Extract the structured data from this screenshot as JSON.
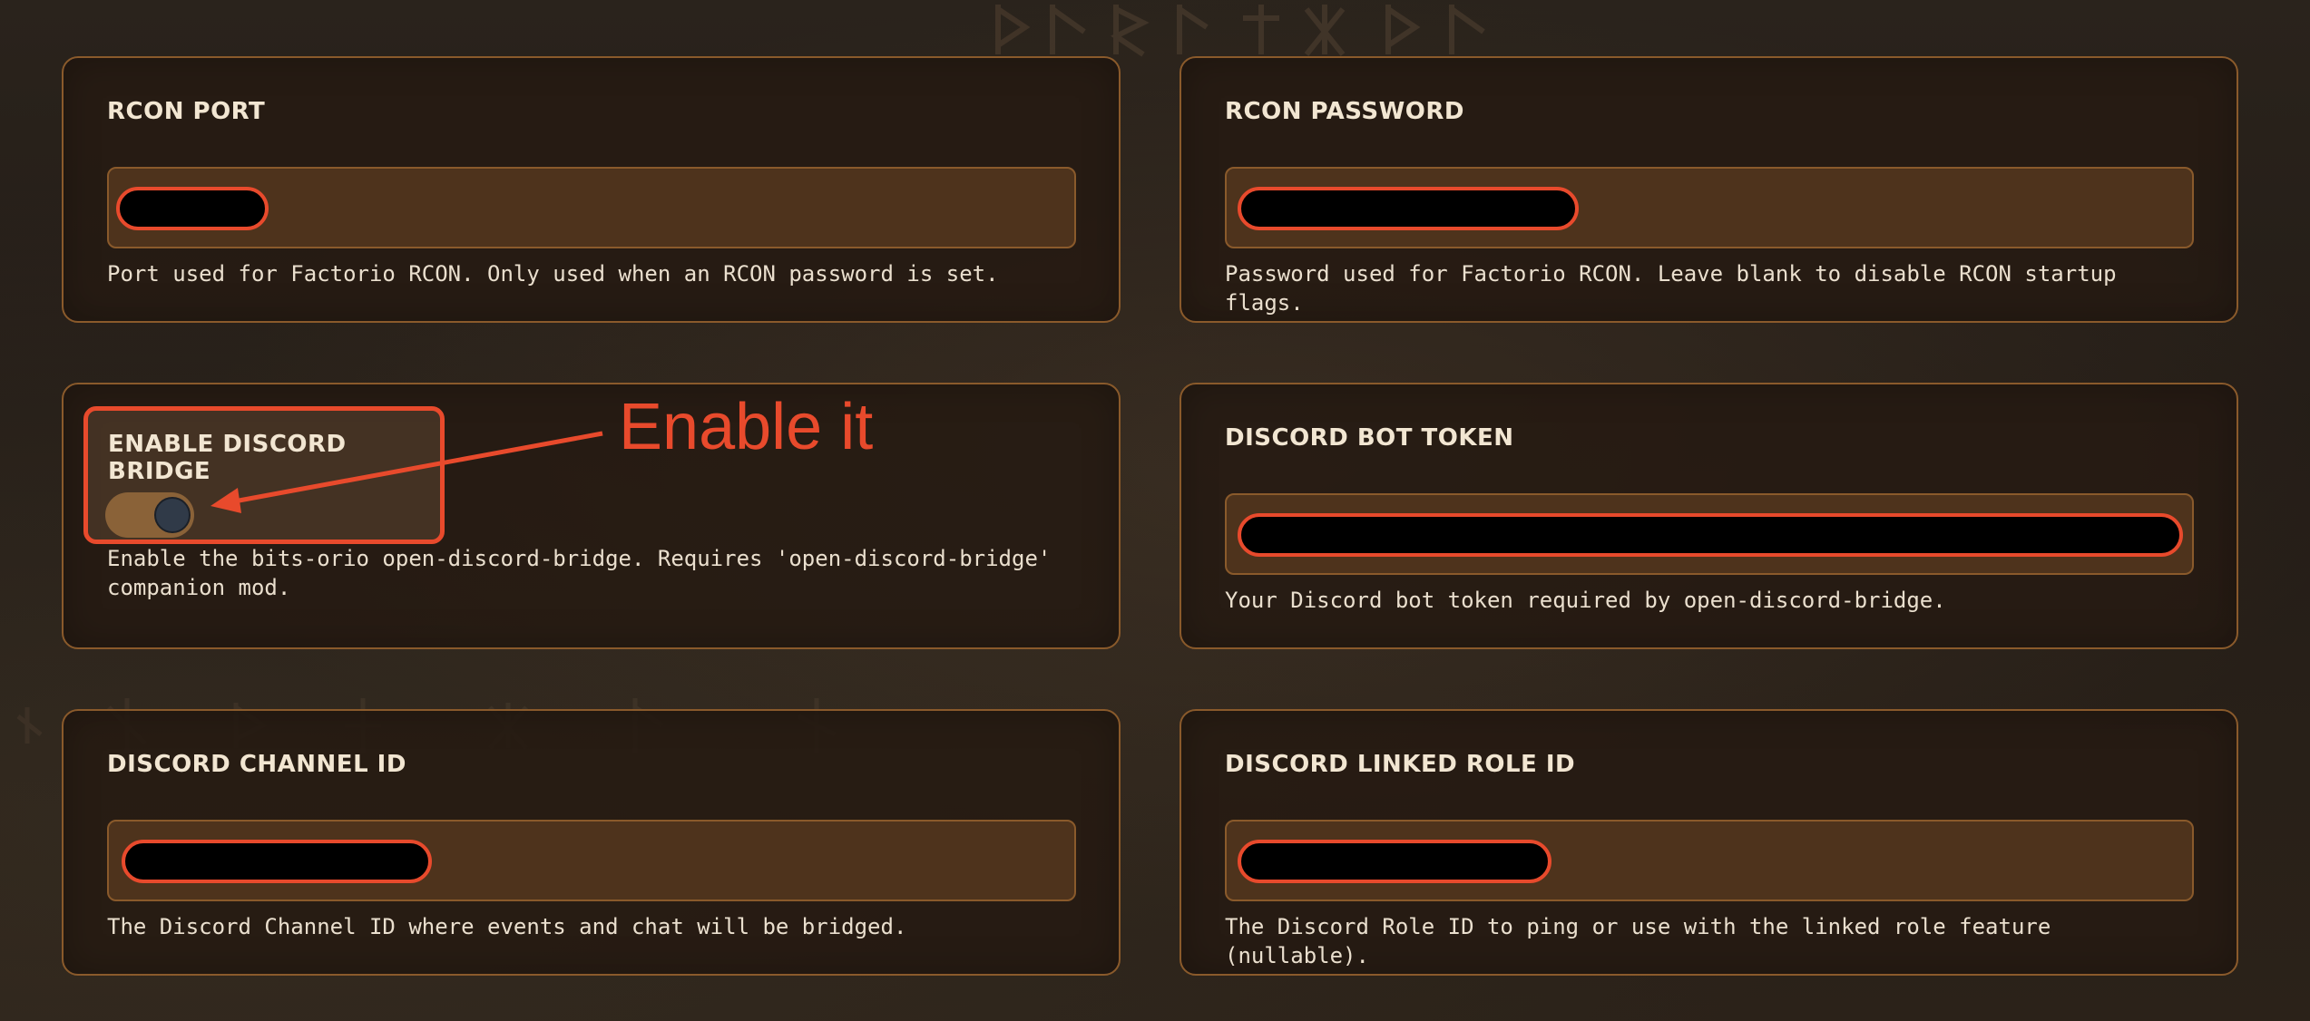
{
  "colors": {
    "accent_red": "#e84a2c",
    "card_border": "#8a5a2b",
    "input_bg": "#4e331c",
    "text": "#f2e6d2"
  },
  "fields": {
    "rcon_port": {
      "label": "RCON PORT",
      "help": "Port used for Factorio RCON. Only used when an RCON password is set."
    },
    "rcon_password": {
      "label": "RCON PASSWORD",
      "help": "Password used for Factorio RCON. Leave blank to disable RCON startup flags."
    },
    "discord_bridge": {
      "label": "ENABLE DISCORD BRIDGE",
      "help": "Enable the bits-orio open-discord-bridge. Requires 'open-discord-bridge' companion mod."
    },
    "discord_bot_token": {
      "label": "DISCORD BOT TOKEN",
      "help": "Your Discord bot token required by open-discord-bridge."
    },
    "discord_channel_id": {
      "label": "DISCORD CHANNEL ID",
      "help": "The Discord Channel ID where events and chat will be bridged."
    },
    "discord_linked_role_id": {
      "label": "DISCORD LINKED ROLE ID",
      "help": "The Discord Role ID to ping or use with the linked role feature (nullable)."
    }
  },
  "annotation": {
    "text": "Enable it"
  }
}
